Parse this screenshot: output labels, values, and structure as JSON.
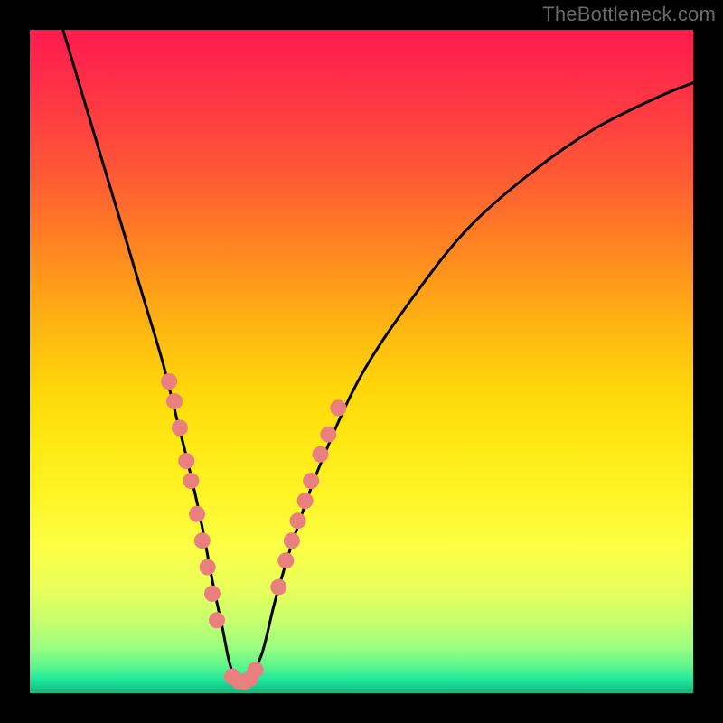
{
  "watermark": "TheBottleneck.com",
  "chart_data": {
    "type": "line",
    "title": "",
    "xlabel": "",
    "ylabel": "",
    "xlim": [
      0,
      100
    ],
    "ylim": [
      0,
      100
    ],
    "series": [
      {
        "name": "bottleneck-curve",
        "x": [
          5,
          8,
          11,
          14,
          17,
          20,
          22,
          24,
          26,
          27.5,
          29,
          30,
          31,
          32,
          33,
          35,
          37,
          40,
          44,
          50,
          58,
          66,
          75,
          85,
          95,
          100
        ],
        "y": [
          100,
          90,
          80,
          70,
          60,
          50,
          42,
          34,
          25,
          17,
          10,
          5,
          2,
          1,
          2,
          6,
          14,
          24,
          35,
          48,
          60,
          70,
          78,
          85,
          90,
          92
        ]
      }
    ],
    "marker_clusters": [
      {
        "name": "left-arm-markers",
        "color": "#e97f7f",
        "points": [
          {
            "x": 21.0,
            "y": 47
          },
          {
            "x": 21.8,
            "y": 44
          },
          {
            "x": 22.6,
            "y": 40
          },
          {
            "x": 23.6,
            "y": 35
          },
          {
            "x": 24.3,
            "y": 32
          },
          {
            "x": 25.2,
            "y": 27
          },
          {
            "x": 26.0,
            "y": 23
          },
          {
            "x": 26.8,
            "y": 19
          },
          {
            "x": 27.5,
            "y": 15
          },
          {
            "x": 28.2,
            "y": 11
          }
        ]
      },
      {
        "name": "valley-markers",
        "color": "#e97f7f",
        "points": [
          {
            "x": 30.5,
            "y": 2.5
          },
          {
            "x": 31.5,
            "y": 1.8
          },
          {
            "x": 32.3,
            "y": 1.7
          },
          {
            "x": 33.2,
            "y": 2.2
          },
          {
            "x": 34.0,
            "y": 3.5
          }
        ]
      },
      {
        "name": "right-arm-markers",
        "color": "#e97f7f",
        "points": [
          {
            "x": 37.5,
            "y": 16
          },
          {
            "x": 38.6,
            "y": 20
          },
          {
            "x": 39.5,
            "y": 23
          },
          {
            "x": 40.4,
            "y": 26
          },
          {
            "x": 41.5,
            "y": 29
          },
          {
            "x": 42.4,
            "y": 32
          },
          {
            "x": 43.8,
            "y": 36
          },
          {
            "x": 45.0,
            "y": 39
          },
          {
            "x": 46.5,
            "y": 43
          }
        ]
      }
    ],
    "background_gradient": {
      "top": "#ff1a4d",
      "bottom": "#14b680"
    }
  }
}
